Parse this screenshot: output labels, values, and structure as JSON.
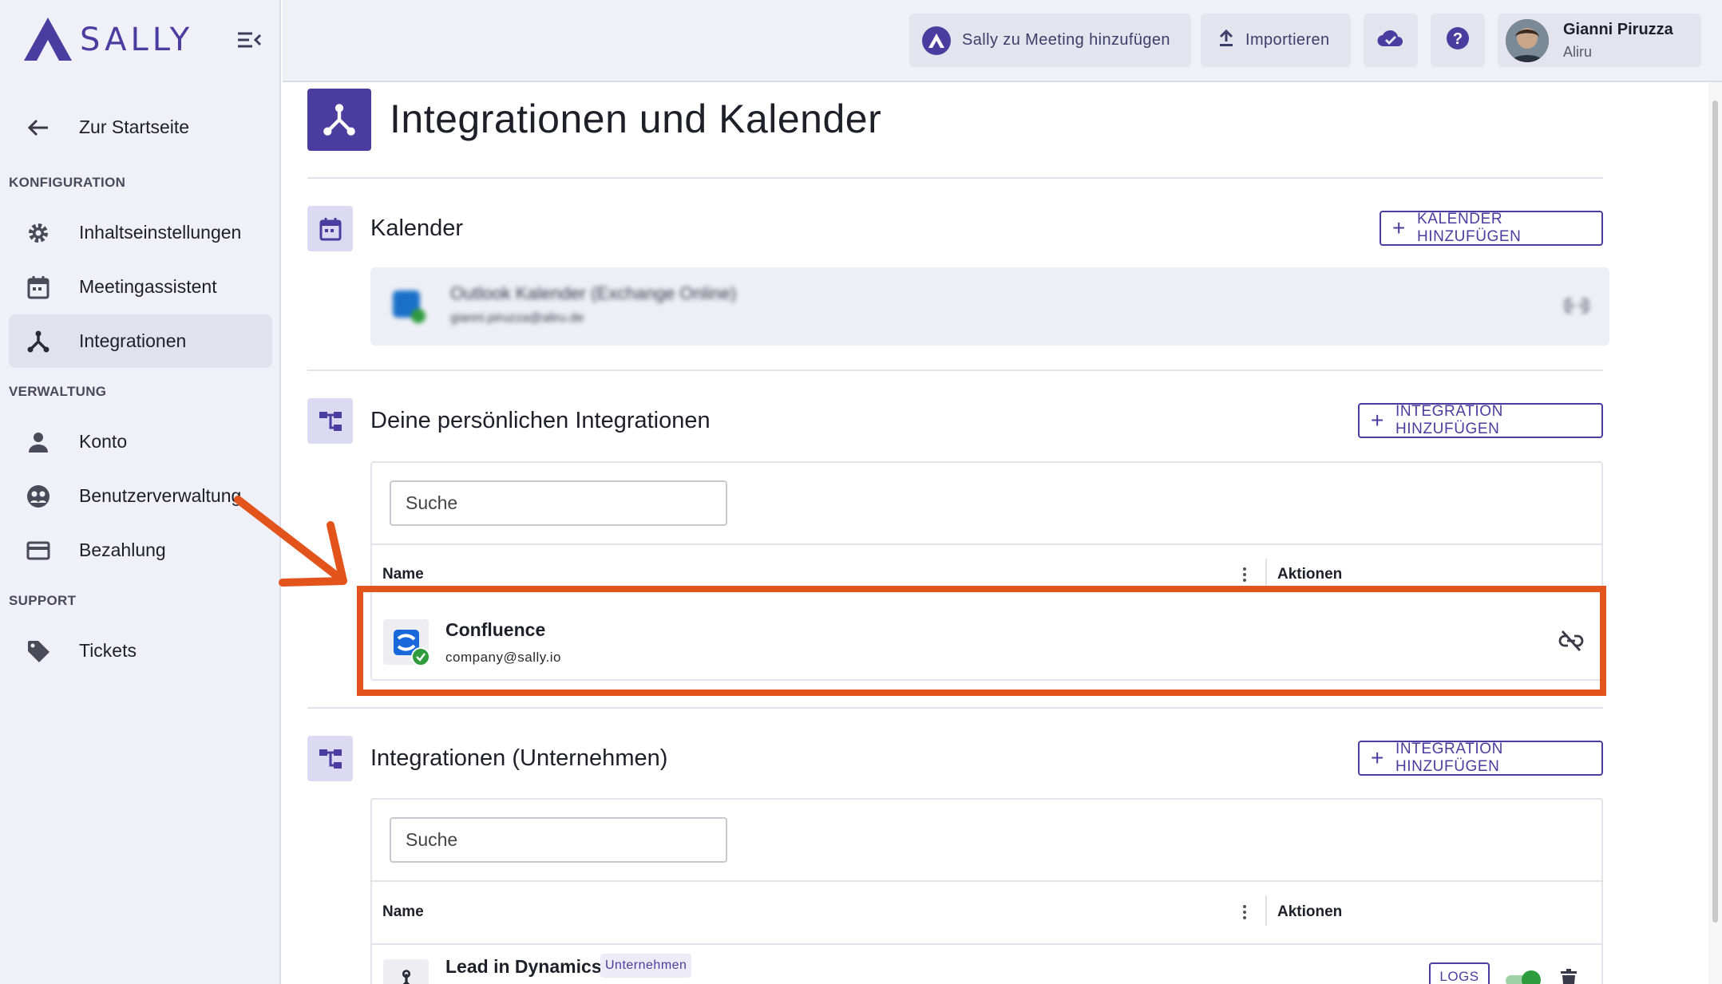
{
  "brand": {
    "name": "SALLY"
  },
  "sidebar": {
    "back_label": "Zur Startseite",
    "sections": [
      {
        "label": "KONFIGURATION",
        "items": [
          {
            "label": "Inhaltseinstellungen",
            "icon": "gear-icon"
          },
          {
            "label": "Meetingassistent",
            "icon": "calendar-icon"
          },
          {
            "label": "Integrationen",
            "icon": "integration-icon",
            "active": true
          }
        ]
      },
      {
        "label": "VERWALTUNG",
        "items": [
          {
            "label": "Konto",
            "icon": "person-icon"
          },
          {
            "label": "Benutzerverwaltung",
            "icon": "users-icon"
          },
          {
            "label": "Bezahlung",
            "icon": "credit-card-icon"
          }
        ]
      },
      {
        "label": "SUPPORT",
        "items": [
          {
            "label": "Tickets",
            "icon": "tag-icon"
          }
        ]
      }
    ]
  },
  "topbar": {
    "add_to_meeting": "Sally zu Meeting hinzufügen",
    "import": "Importieren",
    "user": {
      "name": "Gianni Piruzza",
      "org": "Aliru"
    }
  },
  "page": {
    "title": "Integrationen und Kalender"
  },
  "calendar": {
    "title": "Kalender",
    "add_button": "KALENDER HINZUFÜGEN",
    "entry": {
      "name": "Outlook Kalender (Exchange Online)",
      "email": "gianni.piruzza@aliru.de"
    }
  },
  "personal": {
    "title": "Deine persönlichen Integrationen",
    "add_button": "INTEGRATION HINZUFÜGEN",
    "search_placeholder": "Suche",
    "columns": {
      "name": "Name",
      "actions": "Aktionen"
    },
    "rows": [
      {
        "name": "Confluence",
        "email": "company@sally.io"
      }
    ]
  },
  "company": {
    "title": "Integrationen (Unternehmen)",
    "add_button": "INTEGRATION HINZUFÜGEN",
    "search_placeholder": "Suche",
    "columns": {
      "name": "Name",
      "actions": "Aktionen"
    },
    "rows": [
      {
        "name": "Lead in Dynamics",
        "badge": "Unternehmen",
        "logs_label": "LOGS"
      }
    ]
  },
  "colors": {
    "accent": "#4b3da0",
    "highlight": "#e2541b",
    "success": "#2e9b3c"
  }
}
